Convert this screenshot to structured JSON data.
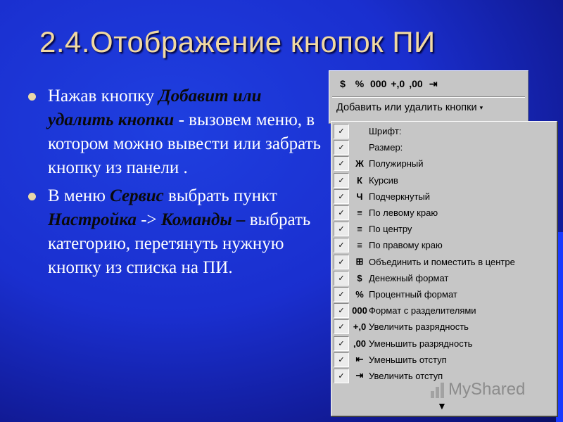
{
  "slide": {
    "title": "2.4.Отображение кнопок ПИ",
    "bullet1": {
      "pre": "Нажав кнопку ",
      "em": "Добавит или удалить кнопки",
      "post": " - вызовем меню, в котором можно вывести или забрать кнопку из панели ."
    },
    "bullet2": {
      "t1": "В меню ",
      "em1": "Сервис",
      "t2": " выбрать пункт ",
      "em2": "Настройка",
      "t3": " -> ",
      "em3": "Команды –",
      "t4": " выбрать категорию, перетянуть нужную кнопку из списка на ПИ."
    }
  },
  "toolbar": {
    "icons": [
      "$",
      "%",
      "000",
      "+,0",
      ",00",
      "⇥"
    ],
    "dropdown_label": "Добавить или удалить кнопки",
    "dropdown_caret": "▾"
  },
  "menu": {
    "items": [
      {
        "icon": "",
        "label": "Шрифт:",
        "checked": "✓"
      },
      {
        "icon": "",
        "label": "Размер:",
        "checked": "✓"
      },
      {
        "icon": "Ж",
        "label": "Полужирный",
        "checked": "✓"
      },
      {
        "icon": "К",
        "label": "Курсив",
        "checked": "✓"
      },
      {
        "icon": "Ч",
        "label": "Подчеркнутый",
        "checked": "✓"
      },
      {
        "icon": "≡",
        "label": "По левому краю",
        "checked": "✓"
      },
      {
        "icon": "≡",
        "label": "По центру",
        "checked": "✓"
      },
      {
        "icon": "≡",
        "label": "По правому краю",
        "checked": "✓"
      },
      {
        "icon": "⊞",
        "label": "Объединить и поместить в центре",
        "checked": "✓"
      },
      {
        "icon": "$",
        "label": "Денежный формат",
        "checked": "✓"
      },
      {
        "icon": "%",
        "label": "Процентный формат",
        "checked": "✓"
      },
      {
        "icon": "000",
        "label": "Формат с разделителями",
        "checked": "✓"
      },
      {
        "icon": "+,0",
        "label": "Увеличить разрядность",
        "checked": "✓"
      },
      {
        "icon": ",00",
        "label": "Уменьшить разрядность",
        "checked": "✓"
      },
      {
        "icon": "⇤",
        "label": "Уменьшить отступ",
        "checked": "✓"
      },
      {
        "icon": "⇥",
        "label": "Увеличить отступ",
        "checked": "✓"
      }
    ],
    "scroll_arrow": "▼"
  },
  "watermark": {
    "text": "MyShared"
  }
}
